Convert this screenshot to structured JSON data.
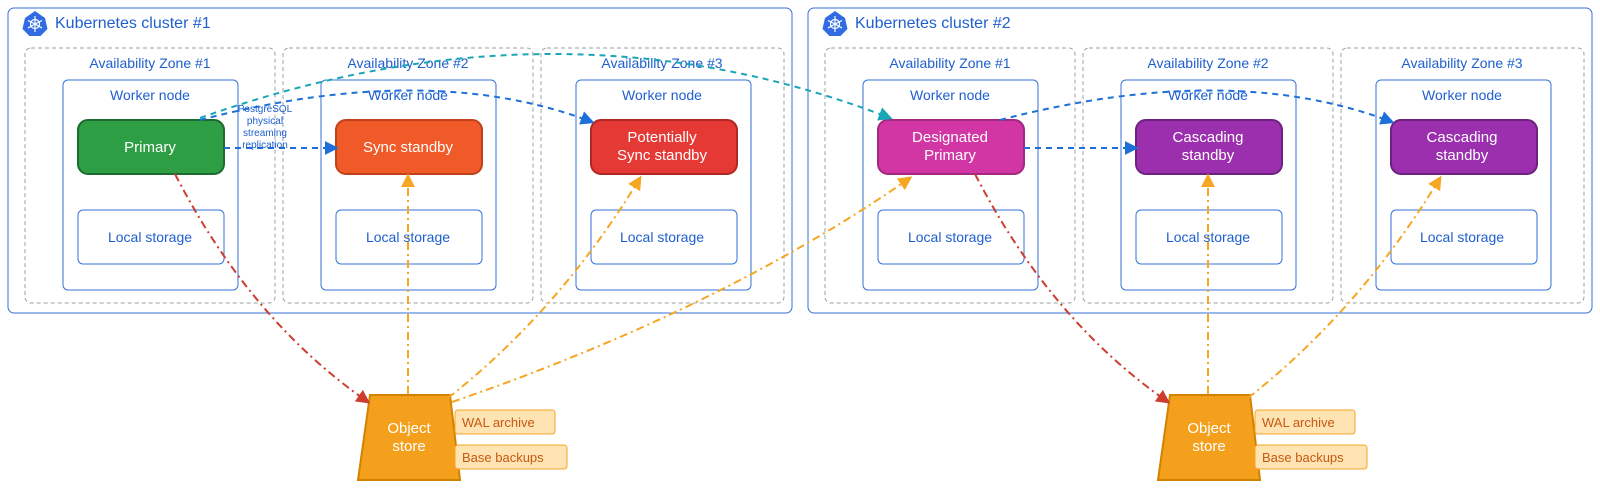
{
  "clusters": [
    {
      "title": "Kubernetes cluster #1",
      "zones": [
        {
          "title": "Availability Zone #1",
          "wn": "Worker node",
          "node": "Primary",
          "node_fill": "#2e9e44",
          "node_stroke": "#1d6b2e",
          "storage": "Local storage"
        },
        {
          "title": "Availability Zone #2",
          "wn": "Worker node",
          "node": "Sync standby",
          "node_fill": "#f05a28",
          "node_stroke": "#c0421b",
          "storage": "Local storage"
        },
        {
          "title": "Availability Zone #3",
          "wn": "Worker node",
          "node": "Potentially\nSync standby",
          "node_fill": "#e53935",
          "node_stroke": "#b02824",
          "storage": "Local storage"
        }
      ],
      "obj_store": "Object\nstore",
      "tag1": "WAL archive",
      "tag2": "Base backups"
    },
    {
      "title": "Kubernetes cluster #2",
      "zones": [
        {
          "title": "Availability Zone #1",
          "wn": "Worker node",
          "node": "Designated\nPrimary",
          "node_fill": "#d136a4",
          "node_stroke": "#a32880",
          "storage": "Local storage"
        },
        {
          "title": "Availability Zone #2",
          "wn": "Worker node",
          "node": "Cascading\nstandby",
          "node_fill": "#9b2fae",
          "node_stroke": "#6f2180",
          "storage": "Local storage"
        },
        {
          "title": "Availability Zone #3",
          "wn": "Worker node",
          "node": "Cascading\nstandby",
          "node_fill": "#9b2fae",
          "node_stroke": "#6f2180",
          "storage": "Local storage"
        }
      ],
      "obj_store": "Object\nstore",
      "tag1": "WAL archive",
      "tag2": "Base backups"
    }
  ],
  "replication_label": "PostgreSQL\nphysical\nstreaming\nreplication",
  "colors": {
    "blue": "#1e5fce",
    "dash_blue": "#1e6fd8",
    "teal": "#1aa6b7",
    "orange": "#f5a623",
    "red": "#cc3e2f",
    "store": "#f5a01d"
  }
}
